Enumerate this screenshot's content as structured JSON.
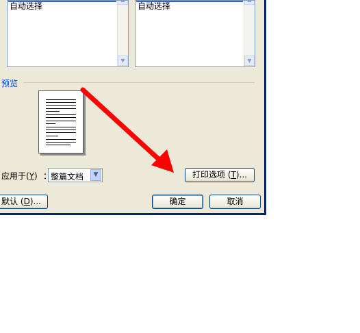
{
  "lists": {
    "left_item": "自动选择",
    "right_item": "自动选择"
  },
  "preview": {
    "label": "预览"
  },
  "apply": {
    "label": "应用于",
    "accel": "Y",
    "separator": "：",
    "value": "整篇文档"
  },
  "buttons": {
    "print_options": {
      "text": "打印选项",
      "accel": "T",
      "suffix": "..."
    },
    "default": {
      "text": "默认",
      "accel": "D",
      "suffix": "..."
    },
    "ok": "确定",
    "cancel": "取消"
  },
  "icons": {
    "scroll_up": "▲",
    "scroll_down": "▼",
    "dropdown": "▼"
  },
  "colors": {
    "annotation_arrow": "#ff0000",
    "dialog_bg": "#ece9d8",
    "frame": "#0a246a"
  }
}
